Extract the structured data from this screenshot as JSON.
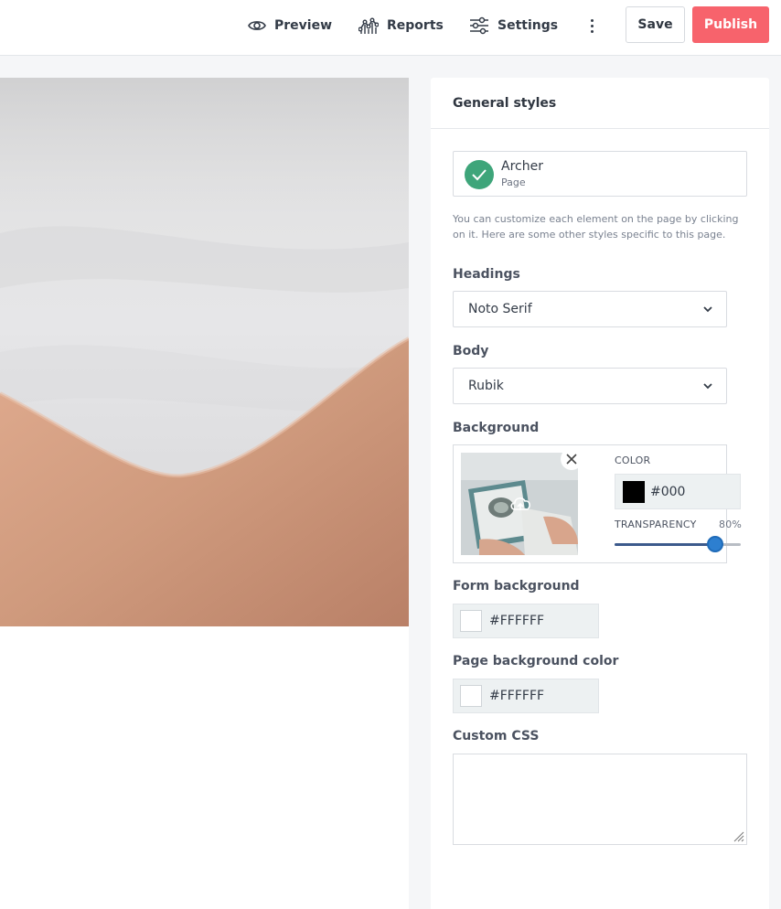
{
  "topbar": {
    "preview_label": "Preview",
    "reports_label": "Reports",
    "settings_label": "Settings",
    "save_label": "Save",
    "publish_label": "Publish"
  },
  "panel": {
    "title": "General styles",
    "theme": {
      "name": "Archer",
      "type": "Page"
    },
    "helper_text": "You can customize each element on the page by clicking on it. Here are some other styles specific to this page.",
    "headings": {
      "label": "Headings",
      "value": "Noto Serif"
    },
    "body": {
      "label": "Body",
      "value": "Rubik"
    },
    "background": {
      "label": "Background",
      "color_label": "COLOR",
      "color_value": "#000",
      "transparency_label": "TRANSPARENCY",
      "transparency_text": "80%",
      "transparency": 0.8
    },
    "form_background": {
      "label": "Form background",
      "value": "#FFFFFF"
    },
    "page_background": {
      "label": "Page background color",
      "value": "#FFFFFF"
    },
    "custom_css": {
      "label": "Custom CSS",
      "value": ""
    }
  },
  "icons": [
    "eye-icon",
    "reports-icon",
    "sliders-icon",
    "kebab-icon",
    "check-icon",
    "chevron-down-icon",
    "close-icon",
    "upload-cloud-icon",
    "resize-grip-icon"
  ],
  "colors": {
    "accent": "#f7636c",
    "success": "#3ea57a",
    "slider": "#2d7fd0"
  }
}
